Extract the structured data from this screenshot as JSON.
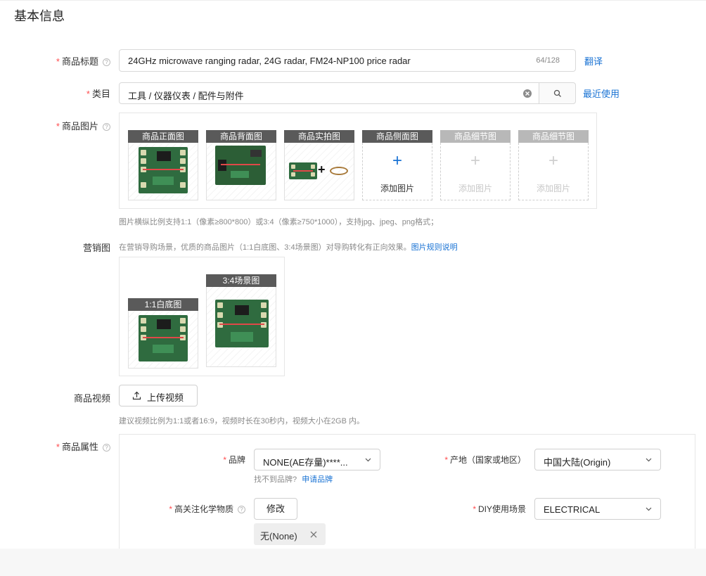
{
  "section": {
    "title": "基本信息"
  },
  "title_field": {
    "label": "商品标题",
    "value": "24GHz microwave ranging radar, 24G radar, FM24-NP100 price radar",
    "counter": "64/128",
    "action": "翻译"
  },
  "category_field": {
    "label": "类目",
    "value": "工具 / 仪器仪表 / 配件与附件",
    "action": "最近使用"
  },
  "images": {
    "label": "商品图片",
    "slots": [
      {
        "title": "商品正面图",
        "state": "filled"
      },
      {
        "title": "商品背面图",
        "state": "filled"
      },
      {
        "title": "商品实拍图",
        "state": "filled"
      },
      {
        "title": "商品侧面图",
        "state": "add",
        "add_label": "添加图片"
      },
      {
        "title": "商品细节图",
        "state": "disabled",
        "add_label": "添加图片"
      },
      {
        "title": "商品细节图",
        "state": "disabled",
        "add_label": "添加图片"
      }
    ],
    "hint": "图片横纵比例支持1:1（像素≥800*800）或3:4（像素≥750*1000），支持jpg、jpeg、png格式；"
  },
  "marketing": {
    "label": "营销图",
    "desc": "在营销导购场景，优质的商品图片（1:1白底图、3:4场景图）对导购转化有正向效果。",
    "link": "图片规则说明",
    "slots": [
      {
        "title": "1:1白底图"
      },
      {
        "title": "3:4场景图"
      }
    ]
  },
  "video": {
    "label": "商品视频",
    "button": "上传视频",
    "hint": "建议视频比例为1:1或者16:9，视频时长在30秒内，视频大小在2GB 内。"
  },
  "attributes": {
    "label": "商品属性",
    "brand": {
      "label": "品牌",
      "value": "NONE(AE存量)****...",
      "not_found": "找不到品牌?",
      "apply": "申请品牌"
    },
    "origin": {
      "label": "产地（国家或地区）",
      "value": "中国大陆(Origin)"
    },
    "chemical": {
      "label": "高关注化学物质",
      "button": "修改",
      "tag": "无(None)"
    },
    "diy": {
      "label": "DIY使用场景",
      "value": "ELECTRICAL"
    }
  },
  "colors": {
    "link": "#1a73d4",
    "required": "#ff4d4f",
    "pcb": "#2f6b3f"
  }
}
